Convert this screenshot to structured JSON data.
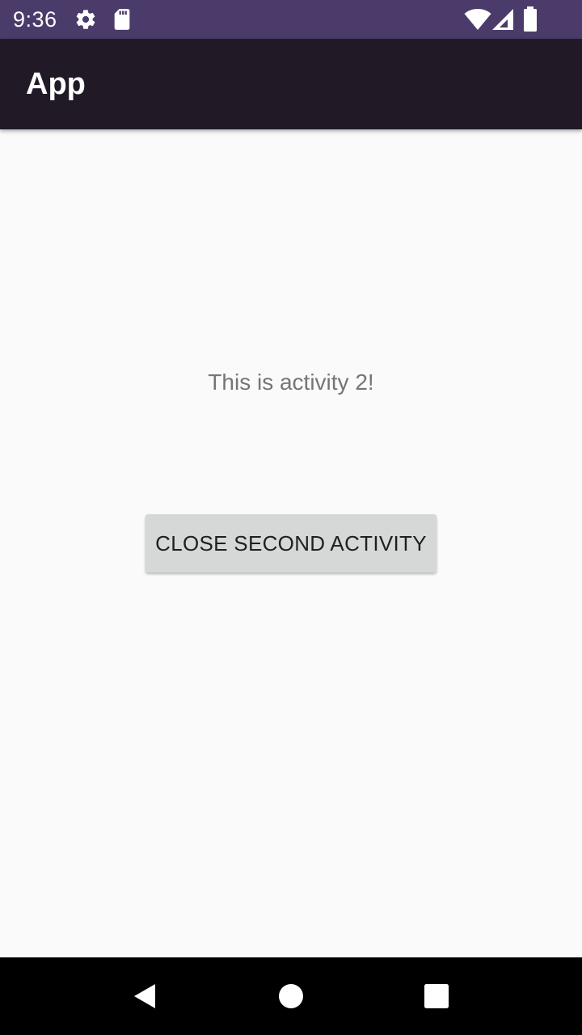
{
  "status_bar": {
    "time": "9:36",
    "icons": [
      "settings-icon",
      "sd-card-icon",
      "wifi-icon",
      "cellular-signal-icon",
      "battery-icon"
    ],
    "background": "#4b3b6b"
  },
  "app_bar": {
    "title": "App",
    "background": "#211a26"
  },
  "main": {
    "message": "This is activity 2!",
    "close_button_label": "CLOSE SECOND ACTIVITY"
  },
  "nav_bar": {
    "buttons": [
      "back-icon",
      "home-icon",
      "recents-icon"
    ],
    "background": "#000000"
  }
}
